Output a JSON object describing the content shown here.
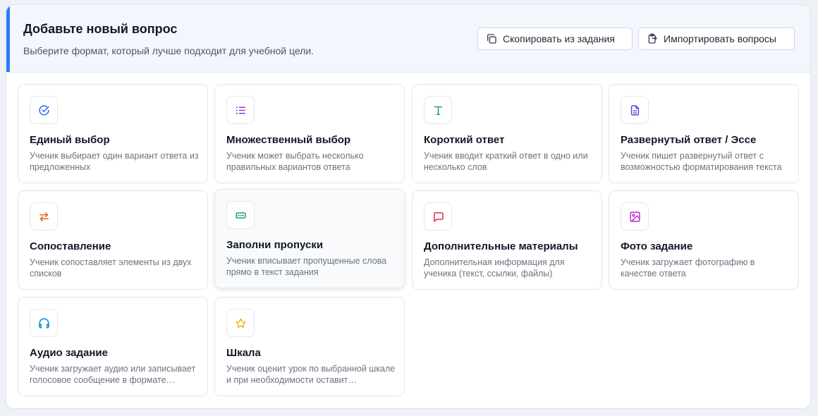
{
  "header": {
    "title": "Добавьте новый вопрос",
    "subtitle": "Выберите формат, который лучше подходит для учебной цели.",
    "copy_label": "Скопировать из задания",
    "import_label": "Импортировать вопросы"
  },
  "colors": {
    "accent": "#2f7bf5",
    "single": "#2563eb",
    "multiple": "#9333ea",
    "short": "#0d9488",
    "essay": "#4f46e5",
    "matching": "#ea580c",
    "fill": "#059669",
    "extra": "#e11d48",
    "photo": "#c026d3",
    "audio": "#0284c7",
    "scale": "#eab308"
  },
  "cards": [
    {
      "icon": "check-circle-icon",
      "title": "Единый выбор",
      "desc": "Ученик выбирает один вариант ответа из предложенных"
    },
    {
      "icon": "list-icon",
      "title": "Множественный выбор",
      "desc": "Ученик может выбрать несколько правильных вариантов ответа"
    },
    {
      "icon": "text-icon",
      "title": "Короткий ответ",
      "desc": "Ученик вводит краткий ответ в одно или несколько слов"
    },
    {
      "icon": "document-icon",
      "title": "Развернутый ответ / Эссе",
      "desc": "Ученик пишет развернутый ответ с возможностью форматирования текста"
    },
    {
      "icon": "swap-arrows-icon",
      "title": "Сопоставление",
      "desc": "Ученик сопоставляет элементы из двух списков"
    },
    {
      "icon": "input-field-icon",
      "title": "Заполни пропуски",
      "desc": "Ученик вписывает пропущенные слова прямо в текст задания"
    },
    {
      "icon": "message-icon",
      "title": "Дополнительные материалы",
      "desc": "Дополнительная информация для ученика (текст, ссылки, файлы)"
    },
    {
      "icon": "image-icon",
      "title": "Фото задание",
      "desc": "Ученик загружает фотографию в качестве ответа"
    },
    {
      "icon": "headphones-icon",
      "title": "Аудио задание",
      "desc": "Ученик загружает аудио или записывает голосовое сообщение в формате аудиофайла"
    },
    {
      "icon": "star-icon",
      "title": "Шкала",
      "desc": "Ученик оценит урок по выбранной шкале и при необходимости оставит комментарий"
    }
  ]
}
